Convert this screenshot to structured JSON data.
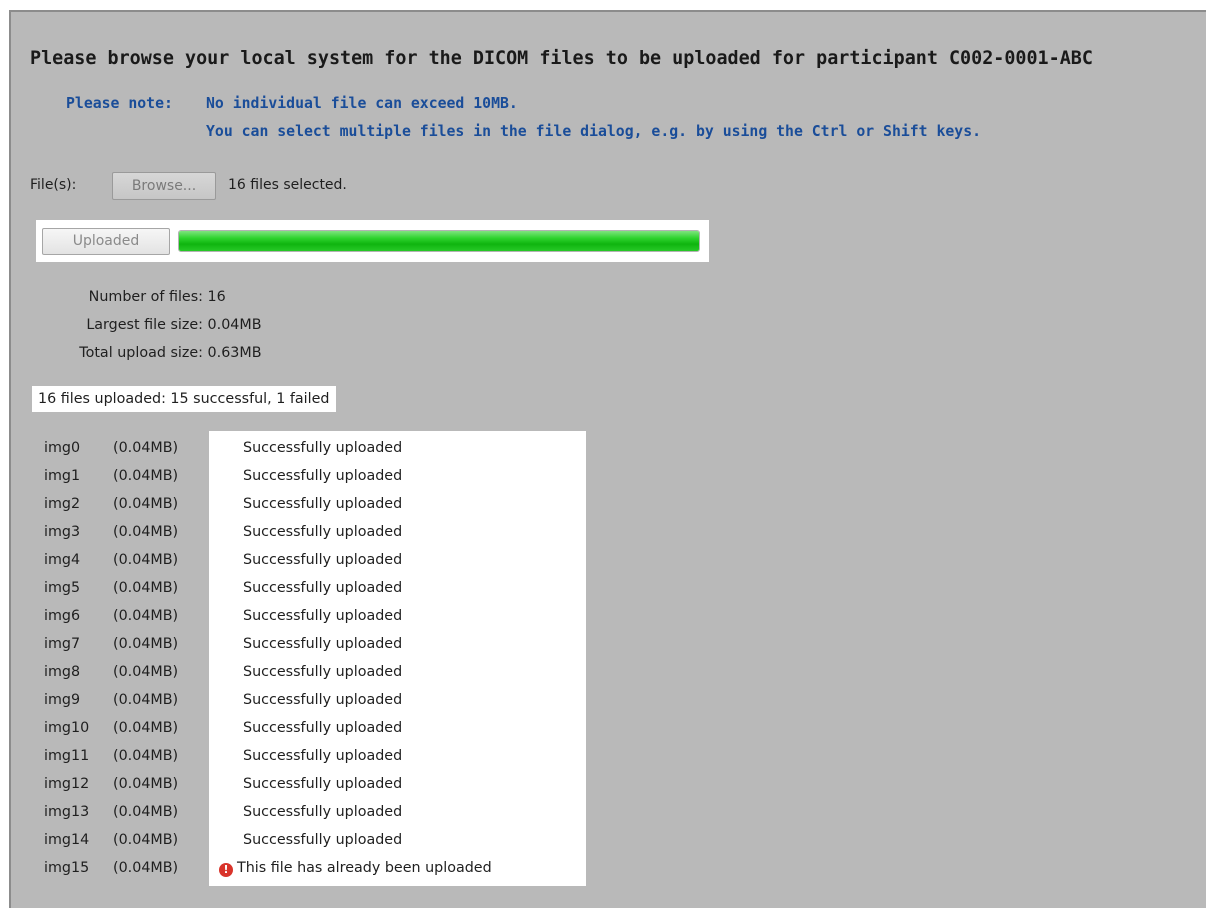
{
  "header": {
    "title": "Please browse your local system for the DICOM files to be uploaded for participant C002-0001-ABC",
    "note_label": "Please note:",
    "note_lines": [
      "No individual file can exceed 10MB.",
      "You can select multiple files in the file dialog, e.g. by using the Ctrl or Shift keys."
    ]
  },
  "file_picker": {
    "label": "File(s):",
    "browse_label": "Browse...",
    "selected_text": "16 files selected."
  },
  "upload": {
    "button_label": "Uploaded",
    "progress_percent": 100,
    "progress_color": "#1ec81e"
  },
  "stats": [
    {
      "label": "Number of files:",
      "value": "16"
    },
    {
      "label": "Largest file size:",
      "value": "0.04MB"
    },
    {
      "label": "Total upload size:",
      "value": "0.63MB"
    }
  ],
  "summary": "16 files uploaded: 15 successful, 1 failed",
  "files": [
    {
      "name": "img0",
      "size": "(0.04MB)",
      "status": "Successfully uploaded",
      "error": false
    },
    {
      "name": "img1",
      "size": "(0.04MB)",
      "status": "Successfully uploaded",
      "error": false
    },
    {
      "name": "img2",
      "size": "(0.04MB)",
      "status": "Successfully uploaded",
      "error": false
    },
    {
      "name": "img3",
      "size": "(0.04MB)",
      "status": "Successfully uploaded",
      "error": false
    },
    {
      "name": "img4",
      "size": "(0.04MB)",
      "status": "Successfully uploaded",
      "error": false
    },
    {
      "name": "img5",
      "size": "(0.04MB)",
      "status": "Successfully uploaded",
      "error": false
    },
    {
      "name": "img6",
      "size": "(0.04MB)",
      "status": "Successfully uploaded",
      "error": false
    },
    {
      "name": "img7",
      "size": "(0.04MB)",
      "status": "Successfully uploaded",
      "error": false
    },
    {
      "name": "img8",
      "size": "(0.04MB)",
      "status": "Successfully uploaded",
      "error": false
    },
    {
      "name": "img9",
      "size": "(0.04MB)",
      "status": "Successfully uploaded",
      "error": false
    },
    {
      "name": "img10",
      "size": "(0.04MB)",
      "status": "Successfully uploaded",
      "error": false
    },
    {
      "name": "img11",
      "size": "(0.04MB)",
      "status": "Successfully uploaded",
      "error": false
    },
    {
      "name": "img12",
      "size": "(0.04MB)",
      "status": "Successfully uploaded",
      "error": false
    },
    {
      "name": "img13",
      "size": "(0.04MB)",
      "status": "Successfully uploaded",
      "error": false
    },
    {
      "name": "img14",
      "size": "(0.04MB)",
      "status": "Successfully uploaded",
      "error": false
    },
    {
      "name": "img15",
      "size": "(0.04MB)",
      "status": "This file has already been uploaded",
      "error": true
    }
  ]
}
